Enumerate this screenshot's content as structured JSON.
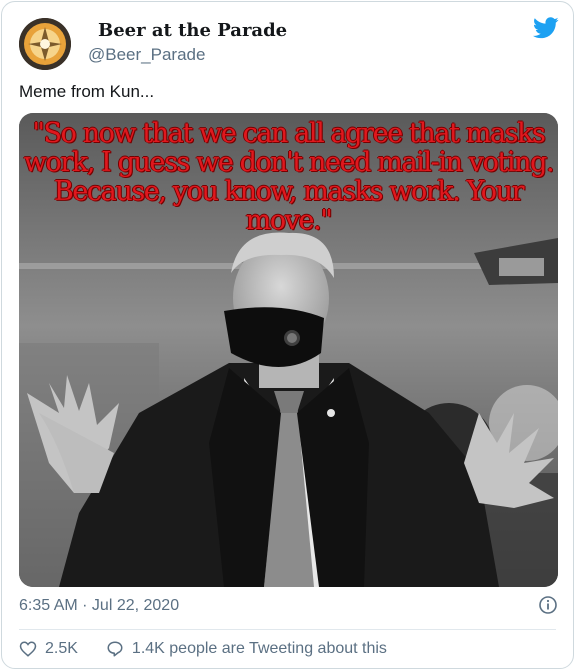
{
  "user": {
    "display_name": "Beer at the Parade",
    "handle": "@Beer_Parade",
    "avatar_icon": "avatar"
  },
  "tweet": {
    "text": "Meme from Kun...",
    "media": {
      "quote": "\"So now that we can all agree that masks work, I guess we don't need mail-in voting. Because, you know, masks work. Your move.\"",
      "quote_color": "#e0181e"
    },
    "timestamp": "6:35 AM · Jul 22, 2020"
  },
  "actions": {
    "likes_count": "2.5K",
    "tweeting_text": "1.4K people are Tweeting about this"
  },
  "colors": {
    "twitter_blue": "#1da1f2",
    "muted": "#5b7083",
    "border": "#cfd9de"
  },
  "icons": [
    "twitter-logo-icon",
    "info-icon",
    "heart-icon",
    "comment-icon"
  ]
}
